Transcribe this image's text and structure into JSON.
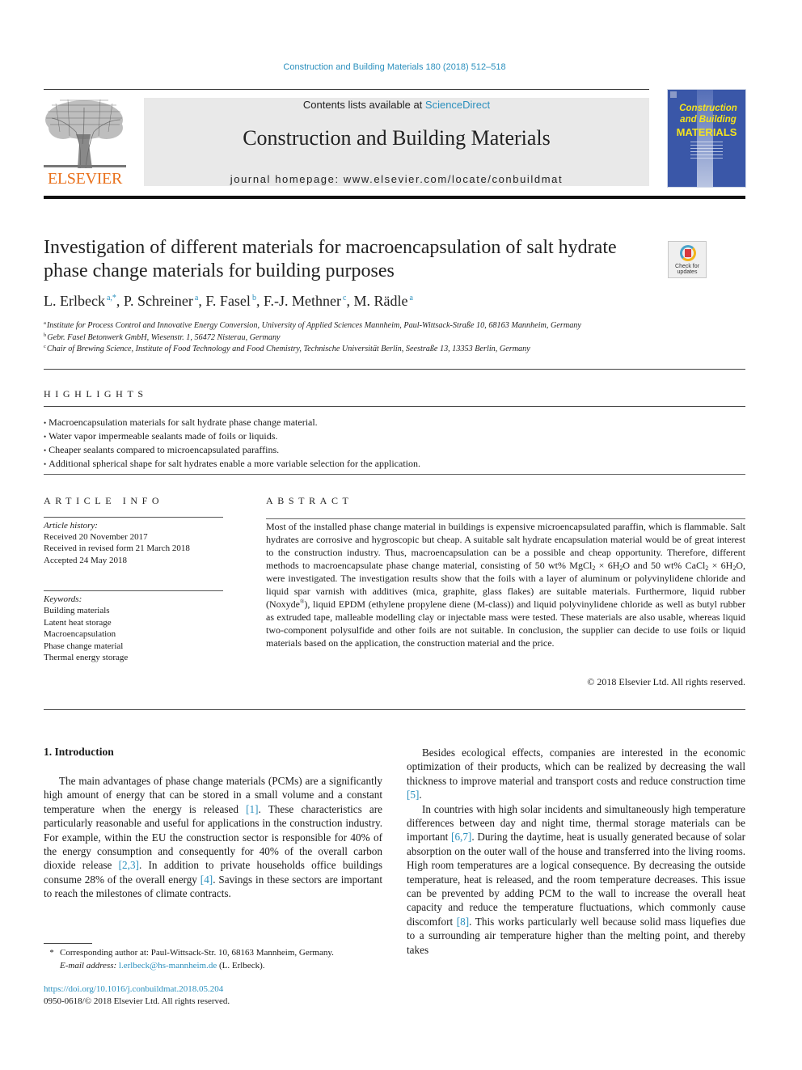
{
  "header": {
    "journal_ref": "Construction and Building Materials 180 (2018) 512–518",
    "contents_prefix": "Contents lists available at ",
    "contents_link": "ScienceDirect",
    "journal_title": "Construction and Building Materials",
    "homepage": "journal homepage: www.elsevier.com/locate/conbuildmat",
    "publisher_logo_text": "ELSEVIER",
    "cover": {
      "title_line1": "Construction",
      "title_line2": "and Building",
      "title_line3": "MATERIALS"
    },
    "crossmark": {
      "line1": "Check for",
      "line2": "updates"
    }
  },
  "article": {
    "title": "Investigation of different materials for macroencapsulation of salt hydrate phase change materials for building purposes",
    "authors": [
      {
        "name": "L. Erlbeck",
        "aff": "a,*",
        "sep": ", "
      },
      {
        "name": "P. Schreiner",
        "aff": "a",
        "sep": ", "
      },
      {
        "name": "F. Fasel",
        "aff": "b",
        "sep": ", "
      },
      {
        "name": "F.-J. Methner",
        "aff": "c",
        "sep": ", "
      },
      {
        "name": "M. Rädle",
        "aff": "a",
        "sep": ""
      }
    ],
    "affiliations": [
      {
        "key": "a",
        "text": "Institute for Process Control and Innovative Energy Conversion, University of Applied Sciences Mannheim, Paul-Wittsack-Straße 10, 68163 Mannheim, Germany"
      },
      {
        "key": "b",
        "text": "Gebr. Fasel Betonwerk GmbH, Wiesenstr. 1, 56472 Nisterau, Germany"
      },
      {
        "key": "c",
        "text": "Chair of Brewing Science, Institute of Food Technology and Food Chemistry, Technische Universität Berlin, Seestraße 13, 13353 Berlin, Germany"
      }
    ]
  },
  "highlights": {
    "heading": "HIGHLIGHTS",
    "items": [
      "Macroencapsulation materials for salt hydrate phase change material.",
      "Water vapor impermeable sealants made of foils or liquids.",
      "Cheaper sealants compared to microencapsulated paraffins.",
      "Additional spherical shape for salt hydrates enable a more variable selection for the application."
    ]
  },
  "article_info": {
    "heading": "ARTICLE INFO",
    "history_label": "Article history:",
    "history": [
      "Received 20 November 2017",
      "Received in revised form 21 March 2018",
      "Accepted 24 May 2018"
    ],
    "keywords_label": "Keywords:",
    "keywords": [
      "Building materials",
      "Latent heat storage",
      "Macroencapsulation",
      "Phase change material",
      "Thermal energy storage"
    ]
  },
  "abstract": {
    "heading": "ABSTRACT",
    "part1": "Most of the installed phase change material in buildings is expensive microencapsulated paraffin, which is flammable. Salt hydrates are corrosive and hygroscopic but cheap. A suitable salt hydrate encapsulation material would be of great interest to the construction industry. Thus, macroencapsulation can be a possible and cheap opportunity. Therefore, different methods to macroencapsulate phase change material, consisting of 50 wt% MgCl",
    "part2": " × 6H",
    "part3": "O and 50 wt% CaCl",
    "part4": " × 6H",
    "part5": "O, were investigated. The investigation results show that the foils with a layer of aluminum or polyvinylidene chloride and liquid spar varnish with additives (mica, graphite, glass flakes) are suitable materials. Furthermore, liquid rubber (Noxyde",
    "part6": "), liquid EPDM (ethylene propylene diene (M-class)) and liquid polyvinylidene chloride as well as butyl rubber as extruded tape, malleable modelling clay or injectable mass were tested. These materials are also usable, whereas liquid two-component polysulfide and other foils are not suitable. In conclusion, the supplier can decide to use foils or liquid materials based on the application, the construction material and the price.",
    "sub2": "2",
    "reg": "®",
    "copyright": "© 2018 Elsevier Ltd. All rights reserved."
  },
  "body": {
    "intro_heading": "1. Introduction",
    "left_p1": [
      {
        "t": "The main advantages of phase change materials (PCMs) are a significantly high amount of energy that can be stored in a small volume and a constant temperature when the energy is released "
      },
      {
        "ref": "[1]"
      },
      {
        "t": ". These characteristics are particularly reasonable and useful for applications in the construction industry. For example, within the EU the construction sector is responsible for 40% of the energy consumption and consequently for 40% of the overall carbon dioxide release "
      },
      {
        "ref": "[2,3]"
      },
      {
        "t": ". In addition to private households office buildings consume 28% of the overall energy "
      },
      {
        "ref": "[4]"
      },
      {
        "t": ". Savings in these sectors are important to reach the milestones of climate contracts."
      }
    ],
    "right_p1": [
      {
        "t": "Besides ecological effects, companies are interested in the economic optimization of their products, which can be realized by decreasing the wall thickness to improve material and transport costs and reduce construction time "
      },
      {
        "ref": "[5]"
      },
      {
        "t": "."
      }
    ],
    "right_p2": [
      {
        "t": "In countries with high solar incidents and simultaneously high temperature differences between day and night time, thermal storage materials can be important "
      },
      {
        "ref": "[6,7]"
      },
      {
        "t": ". During the daytime, heat is usually generated because of solar absorption on the outer wall of the house and transferred into the living rooms. High room temperatures are a logical consequence. By decreasing the outside temperature, heat is released, and the room temperature decreases. This issue can be prevented by adding PCM to the wall to increase the overall heat capacity and reduce the temperature fluctuations, which commonly cause discomfort "
      },
      {
        "ref": "[8]"
      },
      {
        "t": ". This works particularly well because solid mass liquefies due to a surrounding air temperature higher than the melting point, and thereby takes"
      }
    ]
  },
  "footnote": {
    "star": "*",
    "corresponding": "Corresponding author at: Paul-Wittsack-Str. 10, 68163 Mannheim, Germany.",
    "email_label": "E-mail address:",
    "email": "l.erlbeck@hs-mannheim.de",
    "email_suffix": " (L. Erlbeck).",
    "doi": "https://doi.org/10.1016/j.conbuildmat.2018.05.204",
    "issn": "0950-0618/© 2018 Elsevier Ltd. All rights reserved."
  },
  "colors": {
    "link": "#2a8fbd",
    "elsevier_orange": "#e9711c",
    "cover_blue": "#3a57a8",
    "cover_yellow": "#f4e21f",
    "masthead_gray": "#e9e9e9"
  }
}
